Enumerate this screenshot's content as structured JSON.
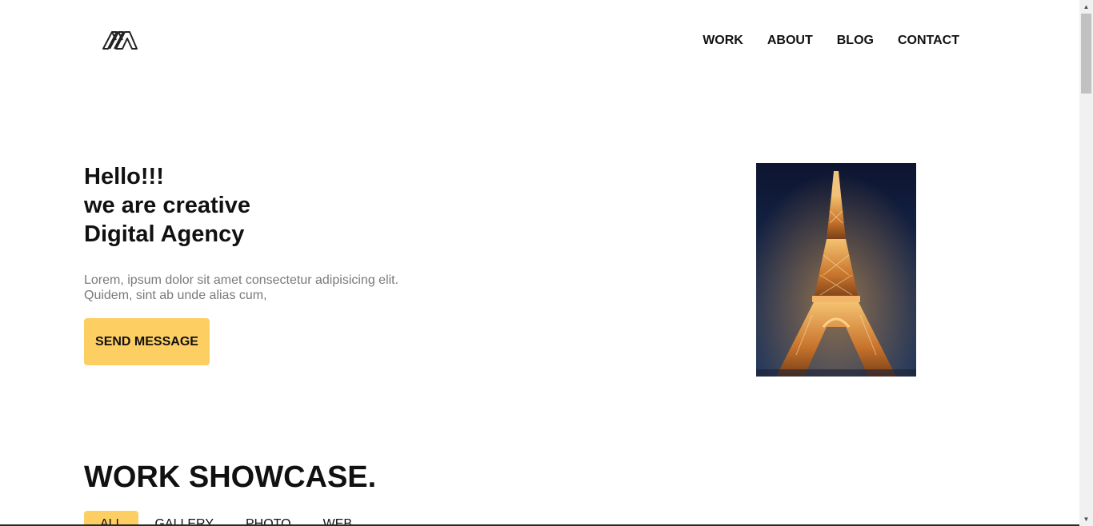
{
  "header": {
    "logo_icon": "mm-logo-icon",
    "nav": [
      {
        "label": "WORK"
      },
      {
        "label": "ABOUT"
      },
      {
        "label": "BLOG"
      },
      {
        "label": "CONTACT"
      }
    ]
  },
  "hero": {
    "title_lines": [
      "Hello!!!",
      "we are creative",
      "Digital Agency"
    ],
    "text_lines": [
      "Lorem, ipsum dolor sit amet consectetur adipisicing elit.",
      "Quidem, sint ab unde alias cum,"
    ],
    "button_label": "SEND MESSAGE",
    "image_icon": "eiffel-tower-photo"
  },
  "showcase": {
    "title": "WORK SHOWCASE.",
    "filters": [
      {
        "label": "ALL",
        "active": true
      },
      {
        "label": "GALLERY",
        "active": false
      },
      {
        "label": "PHOTO",
        "active": false
      },
      {
        "label": "WEB",
        "active": false
      }
    ]
  },
  "colors": {
    "accent": "#fdcf63",
    "text": "#111111",
    "muted_text": "#7a7a7a",
    "hero_image_sky": "#0d1530"
  },
  "scrollbar": {
    "up_icon": "scroll-up-arrow-icon",
    "down_icon": "scroll-down-arrow-icon"
  }
}
